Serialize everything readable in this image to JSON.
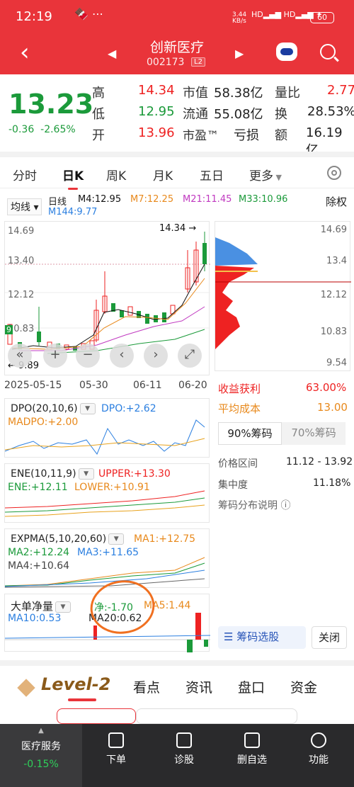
{
  "status": {
    "time": "12:19",
    "net": "3.44\nKB/s",
    "battery": "60"
  },
  "header": {
    "title": "创新医疗",
    "code": "002173",
    "level": "L2"
  },
  "quote": {
    "price": "13.23",
    "change": "-0.36",
    "change_pct": "-2.65%",
    "high_label": "高",
    "high": "14.34",
    "low_label": "低",
    "low": "12.95",
    "open_label": "开",
    "open": "13.96",
    "mktcap_label": "市值",
    "mktcap": "58.38亿",
    "float_label": "流通",
    "float": "55.08亿",
    "pe_label": "市盈™",
    "pe": "亏损",
    "volratio_label": "量比",
    "volratio": "2.77",
    "turnover_label": "换",
    "turnover": "28.53%",
    "amount_label": "额",
    "amount": "16.19亿"
  },
  "tabs": [
    "分时",
    "日K",
    "周K",
    "月K",
    "五日",
    "更多"
  ],
  "ma_line": {
    "mode": "均线",
    "period": "日线",
    "ma4": "M4:12.95",
    "ma7": "M7:12.25",
    "ma21": "M21:11.45",
    "ma33": "M33:10.96",
    "ma144": "M144:9.77",
    "rights": "除权"
  },
  "kline": {
    "y_labels": [
      "14.69",
      "13.40",
      "12.12",
      "10.83"
    ],
    "high_mark": "14.34",
    "low_mark": "9.89",
    "dates": [
      "2025-05-15",
      "05-30",
      "06-11",
      "06-20"
    ],
    "current_price_label": "9"
  },
  "chip": {
    "y_labels": [
      "14.69",
      "13.4",
      "12.12",
      "10.83",
      "9.54"
    ],
    "profit_label": "收益获利",
    "profit": "63.00%",
    "avgcost_label": "平均成本",
    "avgcost": "13.00",
    "tab90": "90%筹码",
    "tab70": "70%筹码",
    "range_label": "价格区间",
    "range": "11.12 - 13.92",
    "conc_label": "集中度",
    "conc": "11.18%",
    "explain": "筹码分布说明",
    "select_btn": "筹码选股",
    "close_btn": "关闭"
  },
  "dpo": {
    "name": "DPO(20,10,6)",
    "dpo": "DPO:+2.62",
    "madpo": "MADPO:+2.00"
  },
  "ene": {
    "name": "ENE(10,11,9)",
    "upper": "UPPER:+13.30",
    "ene": "ENE:+12.11",
    "lower": "LOWER:+10.91"
  },
  "expma": {
    "name": "EXPMA(5,10,20,60)",
    "ma1": "MA1:+12.75",
    "ma2": "MA2:+12.24",
    "ma3": "MA3:+11.65",
    "ma4": "MA4:+10.64"
  },
  "bignet": {
    "name": "大单净量",
    "net": "净:-1.70",
    "ma5": "MA5:1.44",
    "ma10": "MA10:0.53",
    "ma20": "MA20:0.62"
  },
  "bottom_tabs": [
    "Level-2",
    "看点",
    "资讯",
    "盘口",
    "资金"
  ],
  "nav": {
    "sector": "医疗服务",
    "sector_chg": "-0.15%",
    "items": [
      "下单",
      "诊股",
      "删自选",
      "功能"
    ]
  },
  "colors": {
    "up": "#e22222",
    "down": "#1b9a3a",
    "brand": "#e9343a"
  }
}
